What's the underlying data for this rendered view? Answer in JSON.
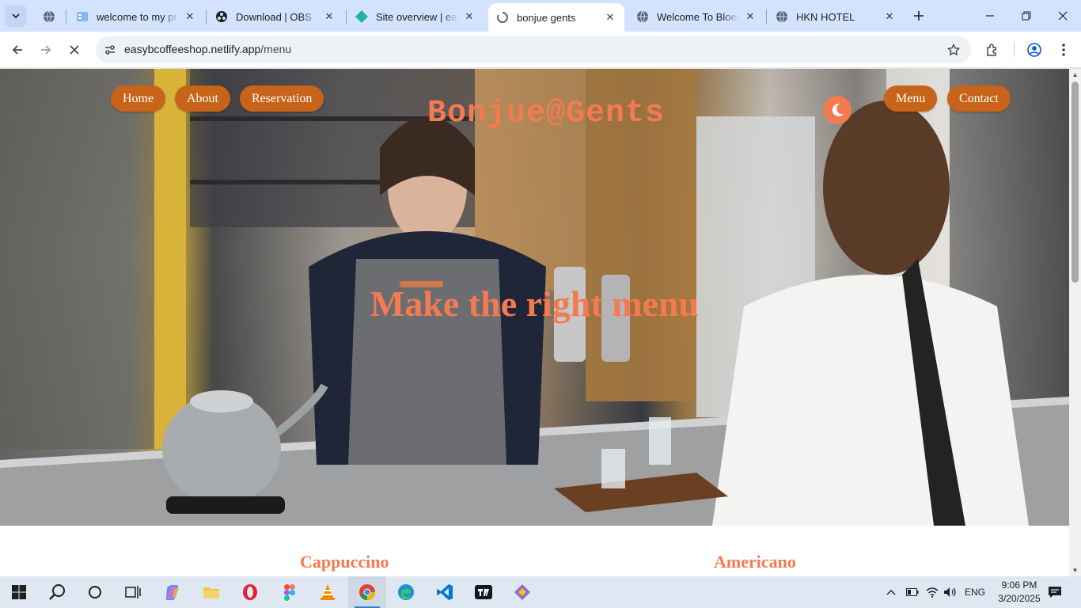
{
  "browser": {
    "tabs": [
      {
        "title": "",
        "icon": "globe-icon"
      },
      {
        "title": "welcome to my pro",
        "icon": "page-icon"
      },
      {
        "title": "Download | OBS",
        "icon": "obs-icon"
      },
      {
        "title": "Site overview | easyb",
        "icon": "netlify-icon"
      },
      {
        "title": "bonjue gents",
        "icon": "loading-icon",
        "active": true
      },
      {
        "title": "Welcome To Bloemf",
        "icon": "globe-icon"
      },
      {
        "title": "HKN HOTEL",
        "icon": "globe-icon"
      }
    ],
    "url_host": "easybcoffeeshop.netlify.app",
    "url_path": "/menu"
  },
  "site": {
    "nav_left": [
      "Home",
      "About",
      "Reservation"
    ],
    "nav_right": [
      "Menu",
      "Contact"
    ],
    "brand": "Bonjue@Gents",
    "headline": "Make the right menu",
    "menu_items": [
      "Cappuccino",
      "Americano"
    ],
    "accent": "#f47a4f",
    "pill_color": "#c8641a"
  },
  "taskbar": {
    "language": "ENG",
    "time": "9:06 PM",
    "date": "3/20/2025"
  }
}
